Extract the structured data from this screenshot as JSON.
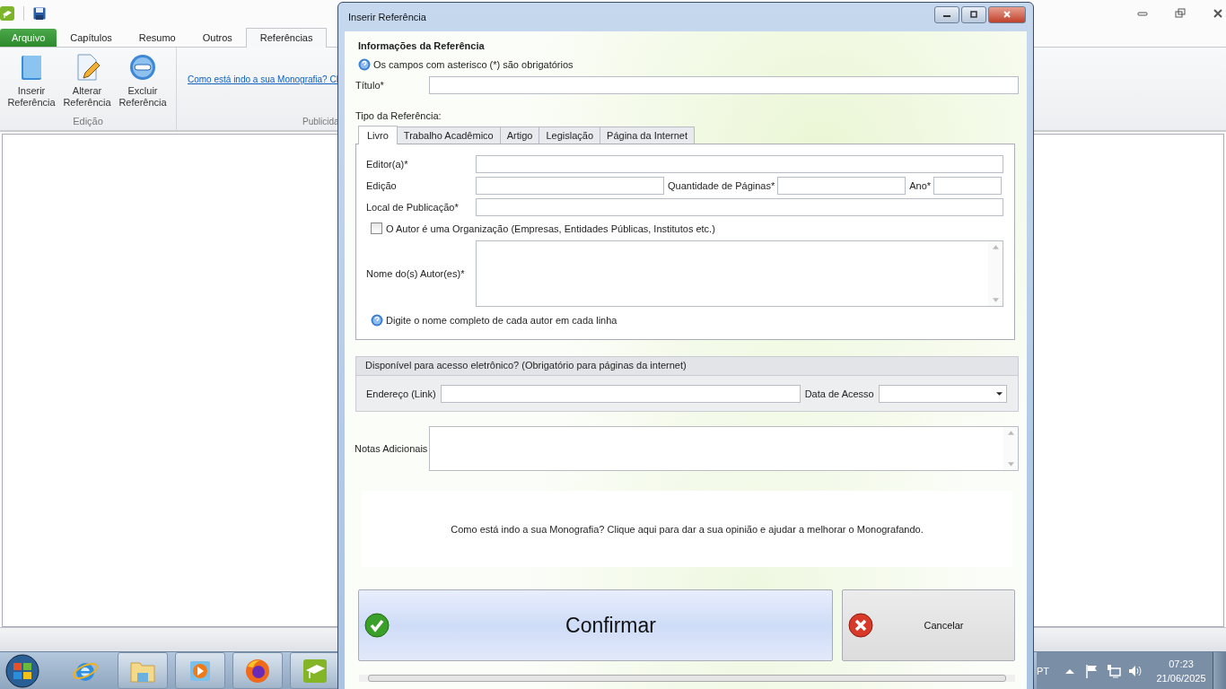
{
  "app": {
    "tabs": [
      {
        "label": "Arquivo",
        "kind": "file",
        "selected": false
      },
      {
        "label": "Capítulos",
        "kind": "tab",
        "selected": false
      },
      {
        "label": "Resumo",
        "kind": "tab",
        "selected": false
      },
      {
        "label": "Outros",
        "kind": "tab",
        "selected": false
      },
      {
        "label": "Referências",
        "kind": "tab",
        "selected": true
      }
    ],
    "ribbon_buttons": [
      {
        "label": "Inserir Referência",
        "kind": "book"
      },
      {
        "label": "Alterar Referência",
        "kind": "edit"
      },
      {
        "label": "Excluir Referência",
        "kind": "remove"
      }
    ],
    "edit_group": "Edição",
    "feedback_link": "Como está indo a sua Monografia? Cl",
    "publicity_group": "Publicida"
  },
  "dialog": {
    "title": "Inserir Referência",
    "section_title": "Informações da Referência",
    "required_note": "Os campos com asterisco (*) são obrigatórios",
    "title_label": "Título*",
    "type_label": "Tipo da Referência:",
    "type_tabs": [
      {
        "label": "Livro",
        "selected": true
      },
      {
        "label": "Trabalho Acadêmico",
        "selected": false
      },
      {
        "label": "Artigo",
        "selected": false
      },
      {
        "label": "Legislação",
        "selected": false
      },
      {
        "label": "Página da Internet",
        "selected": false
      }
    ],
    "book_form": {
      "editor": "Editor(a)*",
      "edition": "Edição",
      "pages": "Quantidade de Páginas*",
      "year": "Ano*",
      "place": "Local de Publicação*",
      "organization": {
        "label": "O Autor é uma Organização (Empresas, Entidades Públicas, Institutos etc.)",
        "checked": false
      },
      "authors": "Nome do(s) Autor(es)*",
      "authors_hint": "Digite o nome completo de cada autor em cada linha"
    },
    "electronic": {
      "header": "Disponível para acesso eletrônico? (Obrigatório para páginas da internet)",
      "link_label": "Endereço (Link)",
      "date_label": "Data de Acesso"
    },
    "notes_label": "Notas Adicionais",
    "feedback": "Como está indo a sua Monografia? Clique aqui para dar a sua opinião e ajudar a melhorar o Monografando.",
    "confirm": "Confirmar",
    "cancel": "Cancelar"
  },
  "taskbar": {
    "items": [
      {
        "kind": "ie",
        "running": false
      },
      {
        "kind": "explorer",
        "running": true
      },
      {
        "kind": "media",
        "running": true
      },
      {
        "kind": "firefox",
        "running": true
      },
      {
        "kind": "monografando",
        "running": true
      }
    ],
    "language": "PT",
    "time": "07:23",
    "date": "21/06/2025"
  }
}
